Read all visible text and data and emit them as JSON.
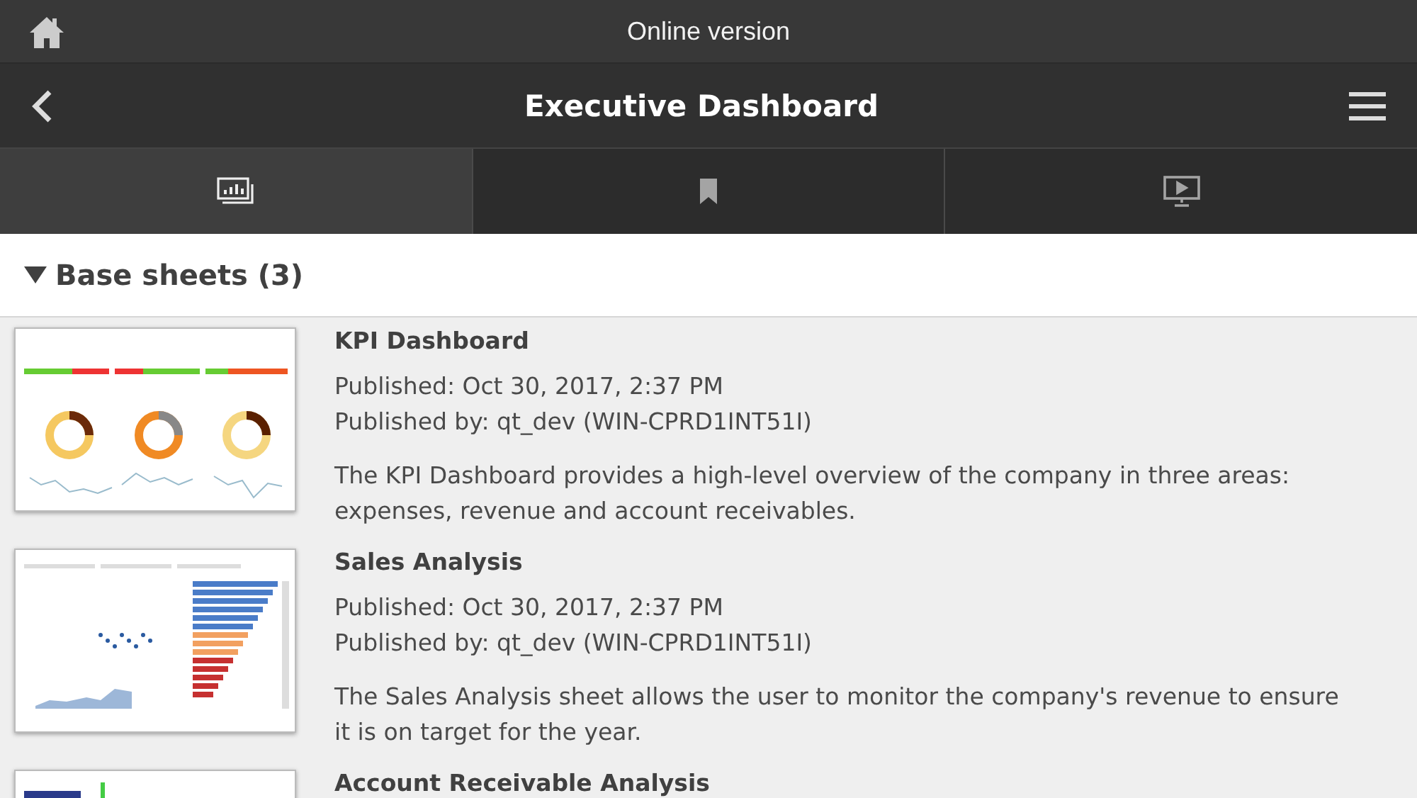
{
  "status_bar": {
    "title": "Online version"
  },
  "header": {
    "title": "Executive Dashboard"
  },
  "tabs": [
    {
      "kind": "sheets",
      "selected": true
    },
    {
      "kind": "bookmarks",
      "selected": false
    },
    {
      "kind": "stories",
      "selected": false
    }
  ],
  "section": {
    "title": "Base sheets (3)",
    "expanded": true
  },
  "sheets": [
    {
      "kind": "kpi",
      "title": "KPI Dashboard",
      "published": "Published: Oct 30, 2017, 2:37 PM",
      "publisher": "Published by: qt_dev (WIN-CPRD1INT51I)",
      "description": "The KPI Dashboard provides a high-level overview of the company in three areas: expenses, revenue and account receivables."
    },
    {
      "kind": "sales",
      "title": "Sales Analysis",
      "published": "Published: Oct 30, 2017, 2:37 PM",
      "publisher": "Published by: qt_dev (WIN-CPRD1INT51I)",
      "description": "The Sales Analysis sheet allows the user to monitor the company's revenue to ensure it is on target for the year."
    },
    {
      "kind": "ar",
      "title": "Account Receivable Analysis"
    }
  ]
}
